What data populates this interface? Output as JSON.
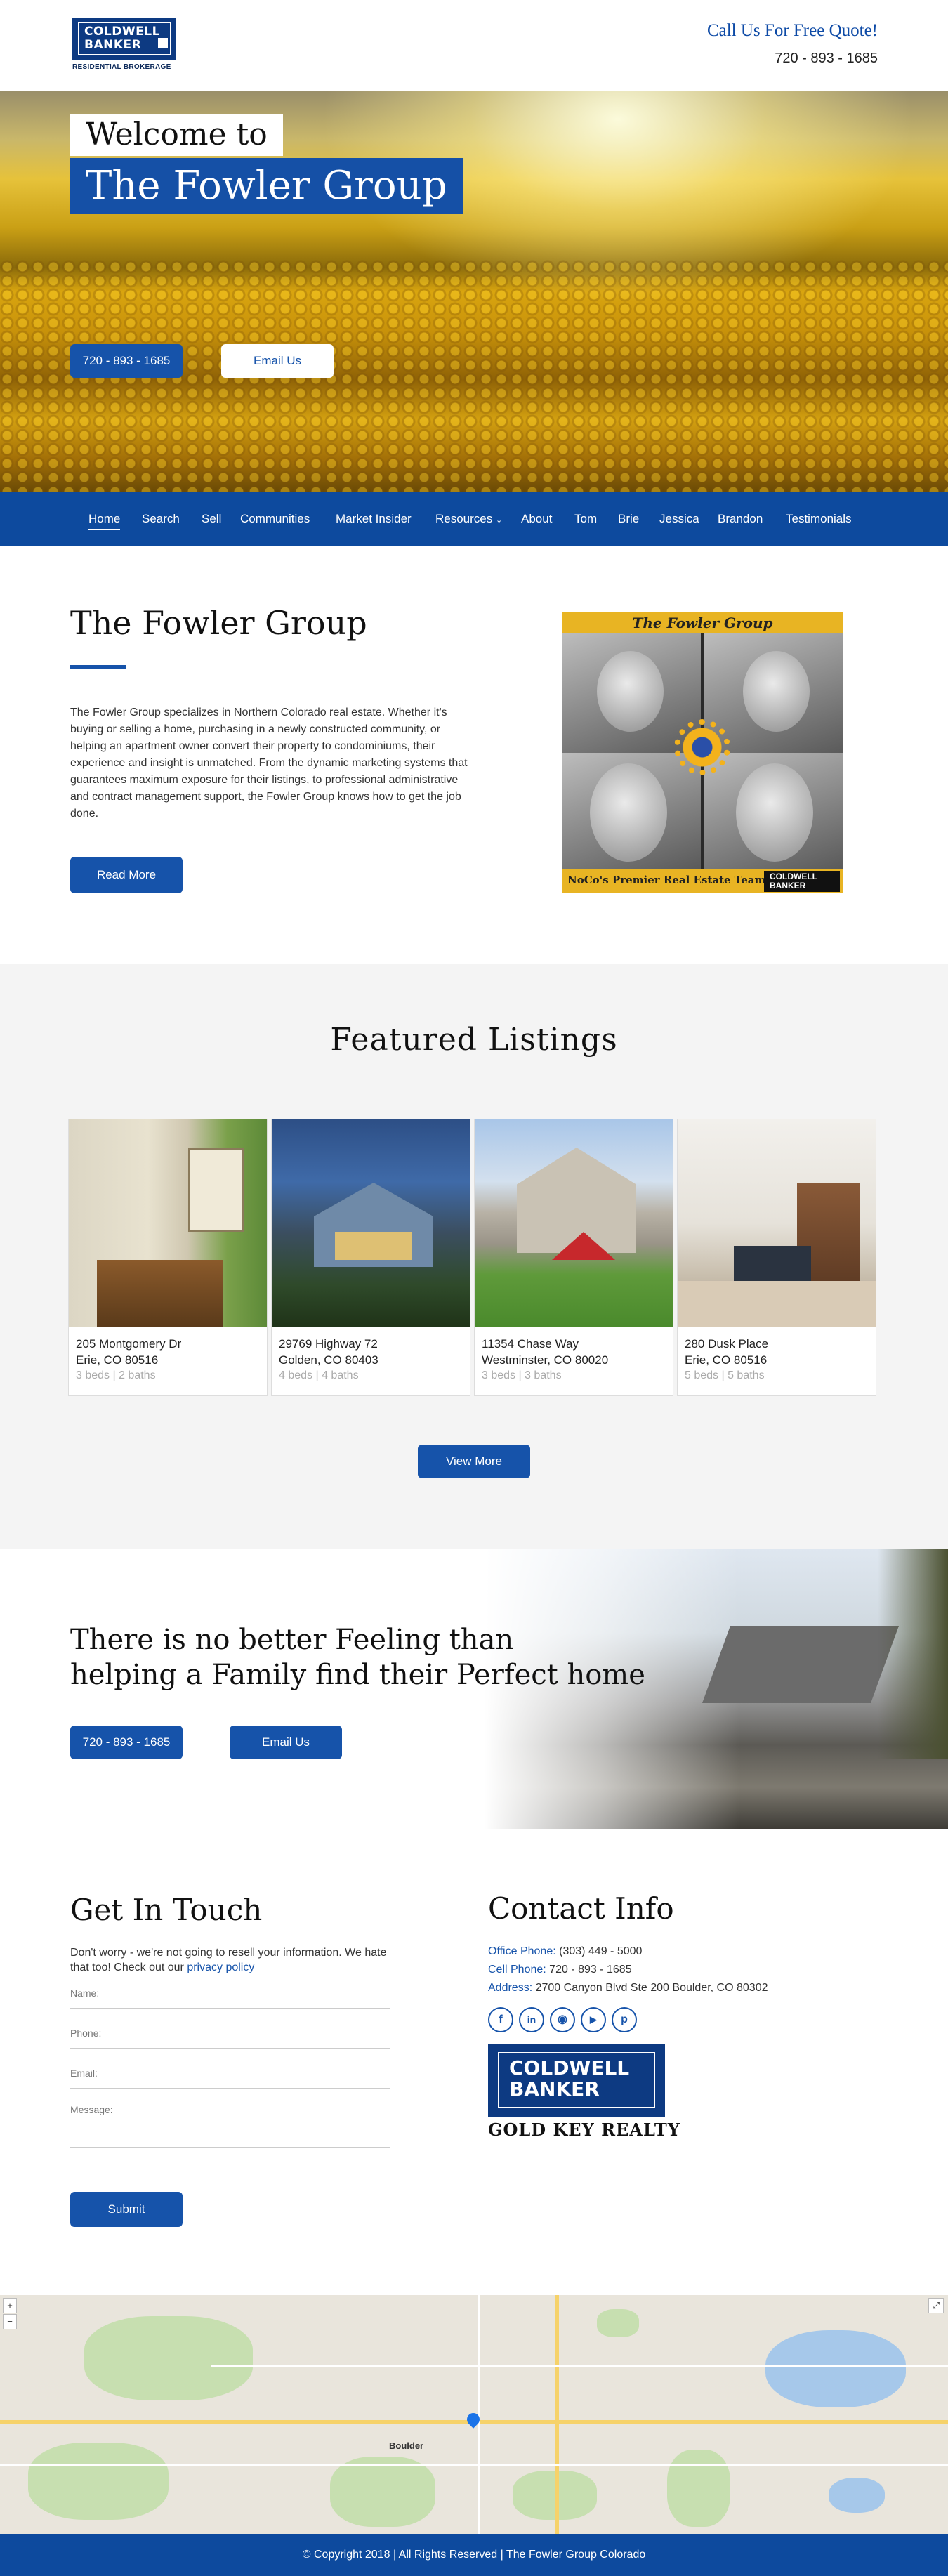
{
  "header": {
    "logo": {
      "line1": "COLDWELL",
      "line2": "BANKER",
      "sub": "RESIDENTIAL BROKERAGE"
    },
    "call_text": "Call Us For Free Quote!",
    "phone": "720 - 893 - 1685"
  },
  "hero": {
    "welcome": "Welcome to",
    "title": "The Fowler Group",
    "phone_button": "720 - 893 - 1685",
    "email_button": "Email Us"
  },
  "nav": {
    "items": [
      "Home",
      "Search",
      "Sell",
      "Communities",
      "Market Insider",
      "Resources",
      "About",
      "Tom",
      "Brie",
      "Jessica",
      "Brandon",
      "Testimonials"
    ],
    "active": "Home"
  },
  "about": {
    "title": "The Fowler Group",
    "text": "The Fowler Group specializes in Northern Colorado real estate. Whether it's buying or selling a home, purchasing in a newly constructed community, or helping an apartment owner convert their property to condominiums, their experience and insight is unmatched. From the dynamic marketing systems that guarantees maximum exposure for their listings, to professional administrative and contract management support, the Fowler Group knows how to get the job done.",
    "read_more": "Read More",
    "image": {
      "banner": "The Fowler Group",
      "tagline": "NoCo's Premier Real Estate Team",
      "logo_line1": "COLDWELL",
      "logo_line2": "BANKER"
    }
  },
  "featured": {
    "title": "Featured  Listings",
    "listings": [
      {
        "street": "205 Montgomery Dr",
        "city": "Erie, CO 80516",
        "details": "3 beds | 2 baths"
      },
      {
        "street": "29769 Highway 72",
        "city": "Golden, CO 80403",
        "details": "4 beds | 4 baths"
      },
      {
        "street": "11354 Chase Way",
        "city": "Westminster, CO 80020",
        "details": "3 beds | 3 baths"
      },
      {
        "street": "280 Dusk Place",
        "city": "Erie, CO 80516",
        "details": "5 beds | 5 baths"
      }
    ],
    "view_more": "View More"
  },
  "feeling": {
    "line1": "There is no better Feeling than",
    "line2": "helping a Family find their Perfect home",
    "phone_button": "720 - 893 - 1685",
    "email_button": "Email Us"
  },
  "contact_form": {
    "title": "Get In Touch",
    "subtitle": "Don't worry - we're not going to resell your information. We hate that too! Check out our",
    "privacy_link": "privacy policy",
    "fields": {
      "name": "Name:",
      "phone": "Phone:",
      "email": "Email:",
      "message": "Message:"
    },
    "submit": "Submit"
  },
  "contact_info": {
    "title": "Contact Info",
    "office_label": "Office Phone:",
    "office_value": "(303) 449 - 5000",
    "cell_label": "Cell Phone:",
    "cell_value": "720 - 893 - 1685",
    "address_label": "Address:",
    "address_value": "2700 Canyon Blvd Ste 200 Boulder, CO 80302",
    "social": [
      "facebook-icon",
      "linkedin-icon",
      "instagram-icon",
      "youtube-icon",
      "pinterest-icon"
    ],
    "logo_line1": "COLDWELL",
    "logo_line2": "BANKER",
    "logo_sub": "GOLD KEY REALTY"
  },
  "map": {
    "city_label": "Boulder",
    "zoom_in": "+",
    "zoom_out": "−"
  },
  "footer": {
    "copyright": "© Copyright 2018 | All Rights Reserved | The Fowler Group Colorado"
  },
  "colors": {
    "brand_blue": "#0d4a9e",
    "button_blue": "#1653aa",
    "accent_gold": "#e8b423"
  }
}
